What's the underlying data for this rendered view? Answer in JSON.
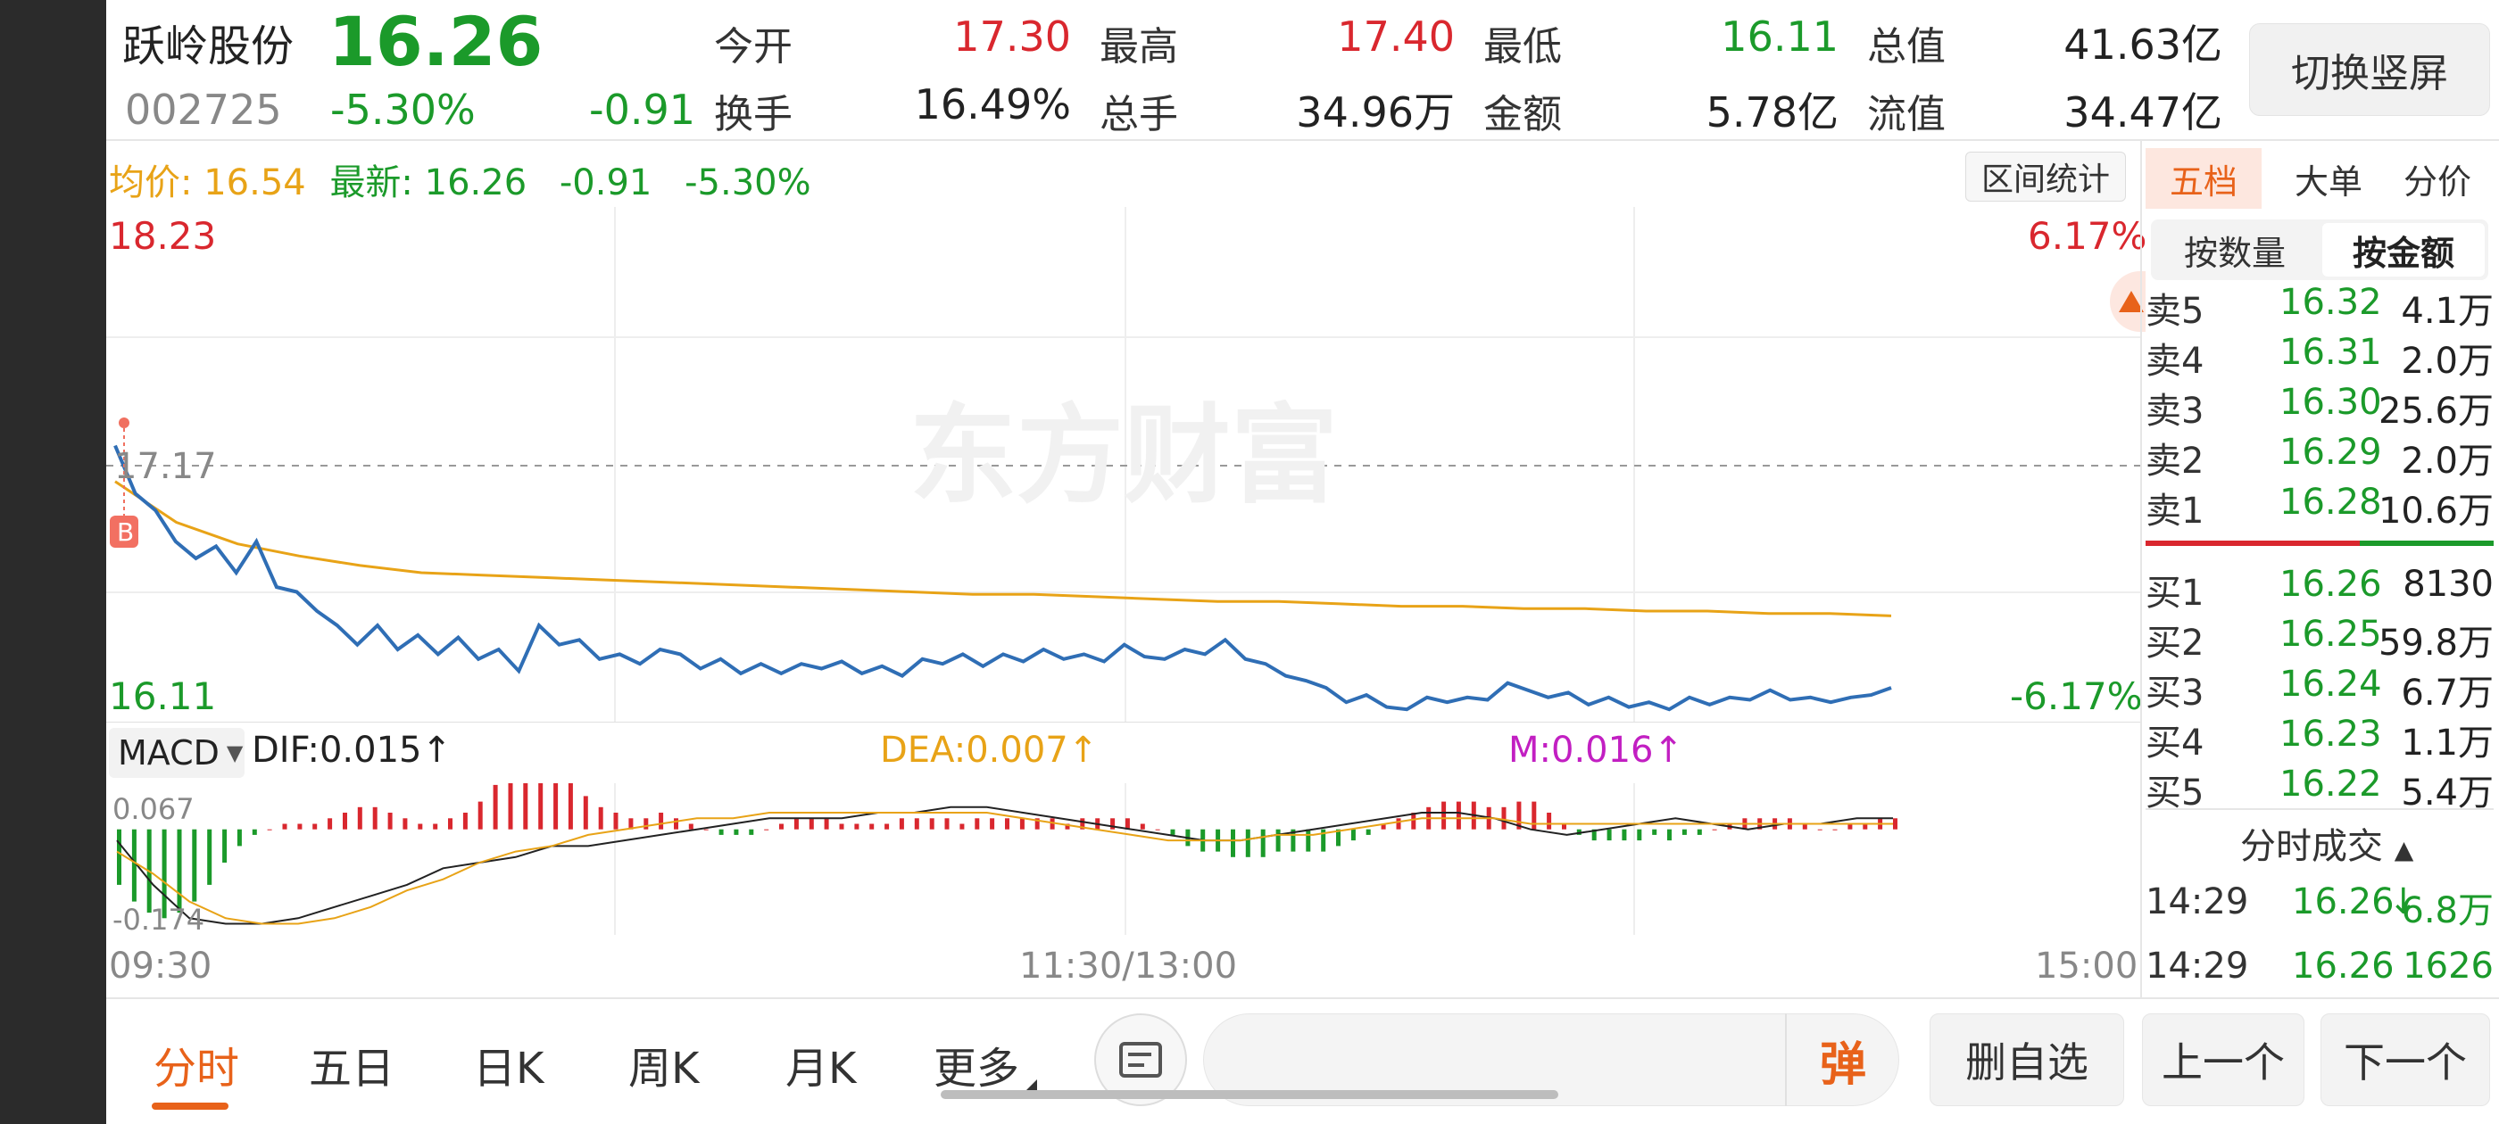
{
  "stock": {
    "name": "跃岭股份",
    "price": "16.26",
    "code": "002725",
    "change_pct": "-5.30%",
    "change": "-0.91"
  },
  "header": {
    "open_label": "今开",
    "open": "17.30",
    "high_label": "最高",
    "high": "17.40",
    "low_label": "最低",
    "low": "16.11",
    "mktcap_label": "总值",
    "mktcap": "41.63亿",
    "turnover_label": "换手",
    "turnover": "16.49%",
    "volume_label": "总手",
    "volume": "34.96万",
    "amount_label": "金额",
    "amount": "5.78亿",
    "float_label": "流值",
    "float_cap": "34.47亿",
    "switch_btn": "切换竖屏"
  },
  "info_line": {
    "avg_label": "均价:",
    "avg": "16.54",
    "latest_label": "最新:",
    "latest": "16.26",
    "chg": "-0.91",
    "chg_pct": "-5.30%"
  },
  "interval_btn": "区间统计",
  "chart": {
    "y_top": "18.23",
    "y_bottom": "16.11",
    "y_prev_close": "17.17",
    "pct_top": "6.17%",
    "pct_bottom": "-6.17%",
    "watermark": "东方财富",
    "marker": "B",
    "time_start": "09:30",
    "time_mid": "11:30/13:00",
    "time_end": "15:00"
  },
  "chart_data": {
    "type": "line",
    "series": [
      {
        "values": [
          17.25,
          17.05,
          16.98,
          16.85,
          16.78,
          16.83,
          16.72,
          16.85,
          16.66,
          16.64,
          16.56,
          16.5,
          16.42,
          16.5,
          16.4,
          16.46,
          16.38,
          16.45,
          16.36,
          16.4,
          16.31,
          16.5,
          16.42,
          16.44,
          16.36,
          16.38,
          16.34,
          16.4,
          16.38,
          16.32,
          16.36,
          16.3,
          16.34,
          16.3,
          16.34,
          16.32,
          16.35,
          16.3,
          16.33,
          16.29,
          16.36,
          16.34,
          16.38,
          16.33,
          16.38,
          16.35,
          16.4,
          16.36,
          16.38,
          16.35,
          16.42,
          16.37,
          16.36,
          16.4,
          16.38,
          16.44,
          16.36,
          16.34,
          16.29,
          16.27,
          16.24,
          16.18,
          16.21,
          16.16,
          16.15,
          16.2,
          16.18,
          16.2,
          16.19,
          16.26,
          16.23,
          16.2,
          16.22,
          16.17,
          16.2,
          16.16,
          16.18,
          16.15,
          16.2,
          16.17,
          16.2,
          16.19,
          16.23,
          16.19,
          16.2,
          16.18,
          16.2,
          16.21,
          16.24
        ]
      },
      {
        "values": [
          17.1,
          16.93,
          16.84,
          16.79,
          16.75,
          16.72,
          16.71,
          16.7,
          16.69,
          16.68,
          16.67,
          16.66,
          16.65,
          16.64,
          16.63,
          16.63,
          16.62,
          16.61,
          16.6,
          16.6,
          16.59,
          16.58,
          16.58,
          16.57,
          16.57,
          16.56,
          16.56,
          16.55,
          16.55,
          16.54
        ]
      }
    ],
    "ylim": [
      16.11,
      18.23
    ]
  },
  "macd": {
    "label": "MACD",
    "dif": "DIF:0.015",
    "dea": "DEA:0.007",
    "m": "M:0.016",
    "arrow": "↑",
    "y_top": "0.067",
    "y_bottom": "-0.174",
    "bars": [
      -0.1,
      -0.13,
      -0.15,
      -0.16,
      -0.15,
      -0.13,
      -0.1,
      -0.06,
      -0.03,
      -0.01,
      0.0,
      0.01,
      0.01,
      0.01,
      0.02,
      0.03,
      0.04,
      0.04,
      0.03,
      0.02,
      0.01,
      0.01,
      0.02,
      0.03,
      0.05,
      0.08,
      0.11,
      0.12,
      0.12,
      0.11,
      0.09,
      0.06,
      0.04,
      0.03,
      0.02,
      0.02,
      0.03,
      0.02,
      0.01,
      0.0,
      -0.01,
      -0.01,
      -0.01,
      0.0,
      0.01,
      0.02,
      0.02,
      0.02,
      0.01,
      0.01,
      0.01,
      0.01,
      0.02,
      0.02,
      0.02,
      0.02,
      0.01,
      0.02,
      0.02,
      0.02,
      0.02,
      0.02,
      0.02,
      0.01,
      0.02,
      0.02,
      0.02,
      0.02,
      0.01,
      0.0,
      -0.01,
      -0.03,
      -0.04,
      -0.04,
      -0.05,
      -0.05,
      -0.05,
      -0.04,
      -0.04,
      -0.04,
      -0.04,
      -0.03,
      -0.02,
      -0.01,
      0.01,
      0.02,
      0.03,
      0.04,
      0.05,
      0.05,
      0.05,
      0.04,
      0.04,
      0.05,
      0.05,
      0.03,
      0.01,
      -0.01,
      -0.02,
      -0.02,
      -0.02,
      -0.02,
      -0.01,
      -0.02,
      -0.01,
      -0.01,
      0.0,
      0.01,
      0.02,
      0.02,
      0.02,
      0.02,
      0.01,
      0.0,
      0.0,
      0.01,
      0.01,
      0.02,
      0.02
    ],
    "dif_line": [
      -0.02,
      -0.1,
      -0.16,
      -0.17,
      -0.17,
      -0.16,
      -0.14,
      -0.12,
      -0.1,
      -0.07,
      -0.06,
      -0.05,
      -0.03,
      -0.03,
      -0.02,
      -0.01,
      0.0,
      0.01,
      0.02,
      0.02,
      0.02,
      0.03,
      0.03,
      0.04,
      0.04,
      0.03,
      0.02,
      0.01,
      0.0,
      -0.01,
      -0.02,
      -0.02,
      -0.01,
      0.0,
      0.01,
      0.02,
      0.03,
      0.03,
      0.02,
      0.0,
      -0.01,
      0.0,
      0.01,
      0.02,
      0.01,
      0.0,
      0.01,
      0.01,
      0.02,
      0.02
    ],
    "dea_line": [
      -0.04,
      -0.08,
      -0.13,
      -0.16,
      -0.17,
      -0.17,
      -0.16,
      -0.14,
      -0.11,
      -0.09,
      -0.06,
      -0.04,
      -0.03,
      -0.01,
      0.0,
      0.01,
      0.02,
      0.02,
      0.03,
      0.03,
      0.03,
      0.03,
      0.03,
      0.03,
      0.03,
      0.02,
      0.01,
      0.0,
      -0.01,
      -0.02,
      -0.02,
      -0.02,
      -0.01,
      -0.01,
      0.0,
      0.01,
      0.02,
      0.02,
      0.02,
      0.01,
      0.01,
      0.01,
      0.01,
      0.01,
      0.01,
      0.01,
      0.01,
      0.01,
      0.01,
      0.01
    ]
  },
  "orderbook": {
    "tabs": [
      "五档",
      "大单",
      "分价"
    ],
    "subtabs": [
      "按数量",
      "按金额"
    ],
    "asks": [
      {
        "label": "卖5",
        "price": "16.32",
        "vol": "4.1万"
      },
      {
        "label": "卖4",
        "price": "16.31",
        "vol": "2.0万"
      },
      {
        "label": "卖3",
        "price": "16.30",
        "vol": "25.6万"
      },
      {
        "label": "卖2",
        "price": "16.29",
        "vol": "2.0万"
      },
      {
        "label": "卖1",
        "price": "16.28",
        "vol": "10.6万"
      }
    ],
    "bids": [
      {
        "label": "买1",
        "price": "16.26",
        "vol": "8130"
      },
      {
        "label": "买2",
        "price": "16.25",
        "vol": "59.8万"
      },
      {
        "label": "买3",
        "price": "16.24",
        "vol": "6.7万"
      },
      {
        "label": "买4",
        "price": "16.23",
        "vol": "1.1万"
      },
      {
        "label": "买5",
        "price": "16.22",
        "vol": "5.4万"
      }
    ],
    "ticks_title": "分时成交",
    "ticks": [
      {
        "time": "14:29",
        "price": "16.26",
        "vol": "6.8万",
        "dir": "↓"
      },
      {
        "time": "14:29",
        "price": "16.26",
        "vol": "1626",
        "dir": ""
      }
    ]
  },
  "bottom": {
    "tabs": [
      "分时",
      "五日",
      "日K",
      "周K",
      "月K",
      "更多"
    ],
    "danmaku_btn": "弹",
    "remove_fav": "删自选",
    "prev": "上一个",
    "next": "下一个"
  },
  "colors": {
    "up": "#d9272e",
    "down": "#1b9a2a",
    "price_line": "#2f6eb5",
    "avg_line": "#e8a317",
    "accent": "#e8621a"
  }
}
